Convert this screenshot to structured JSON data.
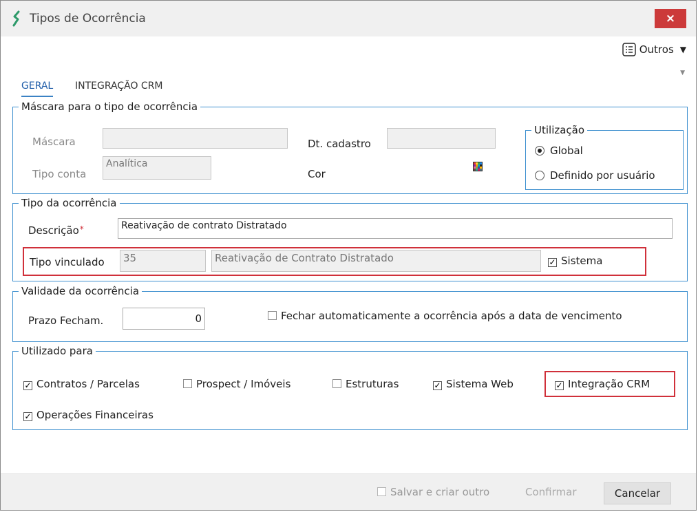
{
  "window": {
    "title": "Tipos de Ocorrência",
    "close_label": "×"
  },
  "toolbar": {
    "outros_label": "Outros"
  },
  "tabs": [
    {
      "label": "GERAL"
    },
    {
      "label": "INTEGRAÇÃO CRM"
    }
  ],
  "mascara_group": {
    "legend": "Máscara para o tipo de ocorrência",
    "mascara_label": "Máscara",
    "mascara_value": "",
    "tipo_conta_label": "Tipo conta",
    "tipo_conta_value": "Analítica",
    "dt_cadastro_label": "Dt. cadastro",
    "dt_cadastro_value": "",
    "cor_label": "Cor"
  },
  "utilizacao_group": {
    "legend": "Utilização",
    "options": [
      {
        "label": "Global",
        "selected": true
      },
      {
        "label": "Definido por usuário",
        "selected": false
      }
    ]
  },
  "tipo_group": {
    "legend": "Tipo da ocorrência",
    "descricao_label": "Descrição",
    "descricao_value": "Reativação de contrato Distratado",
    "tipo_vinculado_label": "Tipo vinculado",
    "tipo_vinculado_code": "35",
    "tipo_vinculado_desc": "Reativação de Contrato Distratado",
    "sistema_label": "Sistema",
    "sistema_checked": true
  },
  "validade_group": {
    "legend": "Validade da ocorrência",
    "prazo_label": "Prazo Fecham.",
    "prazo_value": "0",
    "fechar_label": "Fechar automaticamente a ocorrência após a data de vencimento",
    "fechar_checked": false
  },
  "utilizado_group": {
    "legend": "Utilizado para",
    "items": [
      {
        "label": "Contratos / Parcelas",
        "checked": true
      },
      {
        "label": "Prospect / Imóveis",
        "checked": false
      },
      {
        "label": "Estruturas",
        "checked": false
      },
      {
        "label": "Sistema Web",
        "checked": true
      },
      {
        "label": "Integração CRM",
        "checked": true
      },
      {
        "label": "Operações Financeiras",
        "checked": true
      }
    ]
  },
  "footer": {
    "salvar_label": "Salvar e criar outro",
    "confirmar_label": "Confirmar",
    "cancelar_label": "Cancelar"
  },
  "colors": {
    "accent": "#3d8fcf",
    "highlight": "#d0303a",
    "close": "#cc3a3a"
  }
}
